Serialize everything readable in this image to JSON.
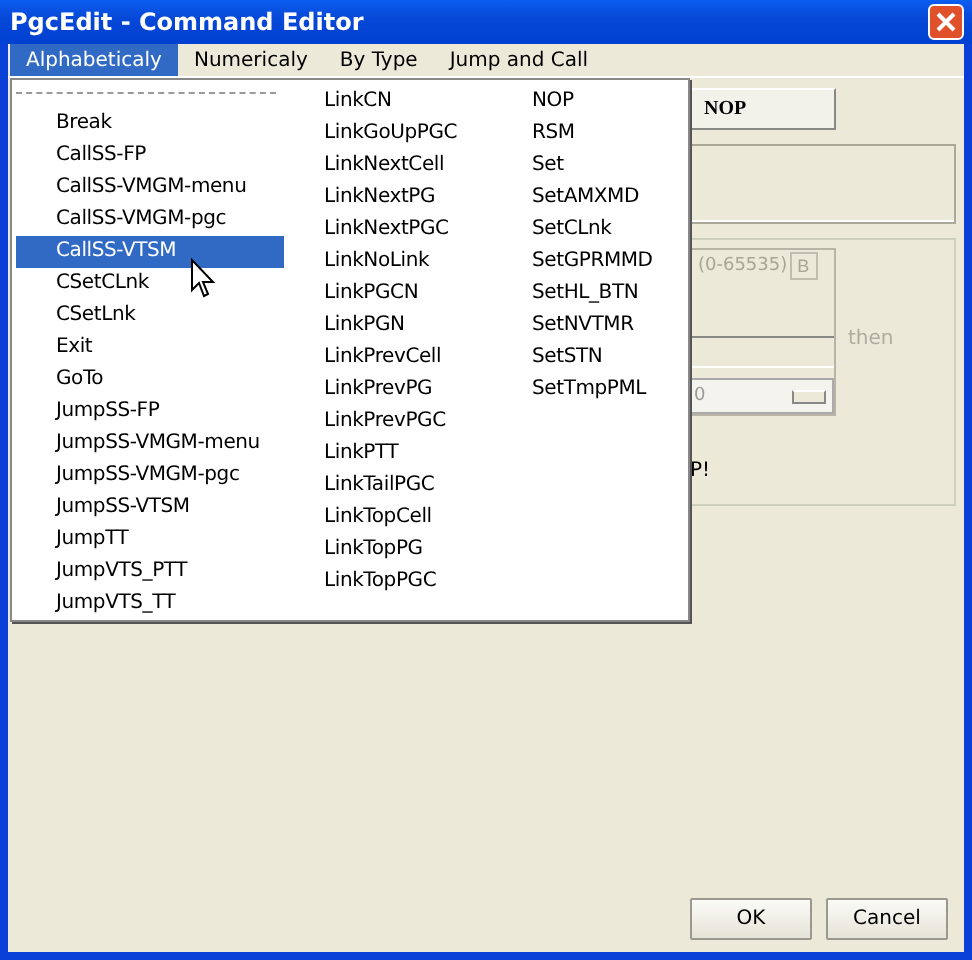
{
  "window": {
    "title": "PgcEdit - Command Editor"
  },
  "menu_bar": [
    {
      "label": "Alphabeticaly",
      "selected": true
    },
    {
      "label": "Numericaly",
      "selected": false
    },
    {
      "label": "By Type",
      "selected": false
    },
    {
      "label": "Jump and Call",
      "selected": false
    }
  ],
  "dropdown": {
    "columns": [
      [
        {
          "label": "Break",
          "selected": false
        },
        {
          "label": "CallSS-FP",
          "selected": false
        },
        {
          "label": "CallSS-VMGM-menu",
          "selected": false
        },
        {
          "label": "CallSS-VMGM-pgc",
          "selected": false
        },
        {
          "label": "CallSS-VTSM",
          "selected": true
        },
        {
          "label": "CSetCLnk",
          "selected": false
        },
        {
          "label": "CSetLnk",
          "selected": false
        },
        {
          "label": "Exit",
          "selected": false
        },
        {
          "label": "GoTo",
          "selected": false
        },
        {
          "label": "JumpSS-FP",
          "selected": false
        },
        {
          "label": "JumpSS-VMGM-menu",
          "selected": false
        },
        {
          "label": "JumpSS-VMGM-pgc",
          "selected": false
        },
        {
          "label": "JumpSS-VTSM",
          "selected": false
        },
        {
          "label": "JumpTT",
          "selected": false
        },
        {
          "label": "JumpVTS_PTT",
          "selected": false
        },
        {
          "label": "JumpVTS_TT",
          "selected": false
        }
      ],
      [
        {
          "label": "LinkCN",
          "selected": false
        },
        {
          "label": "LinkGoUpPGC",
          "selected": false
        },
        {
          "label": "LinkNextCell",
          "selected": false
        },
        {
          "label": "LinkNextPG",
          "selected": false
        },
        {
          "label": "LinkNextPGC",
          "selected": false
        },
        {
          "label": "LinkNoLink",
          "selected": false
        },
        {
          "label": "LinkPGCN",
          "selected": false
        },
        {
          "label": "LinkPGN",
          "selected": false
        },
        {
          "label": "LinkPrevCell",
          "selected": false
        },
        {
          "label": "LinkPrevPG",
          "selected": false
        },
        {
          "label": "LinkPrevPGC",
          "selected": false
        },
        {
          "label": "LinkPTT",
          "selected": false
        },
        {
          "label": "LinkTailPGC",
          "selected": false
        },
        {
          "label": "LinkTopCell",
          "selected": false
        },
        {
          "label": "LinkTopPG",
          "selected": false
        },
        {
          "label": "LinkTopPGC",
          "selected": false
        }
      ],
      [
        {
          "label": "NOP",
          "selected": false
        },
        {
          "label": "RSM",
          "selected": false
        },
        {
          "label": "Set",
          "selected": false
        },
        {
          "label": "SetAMXMD",
          "selected": false
        },
        {
          "label": "SetCLnk",
          "selected": false
        },
        {
          "label": "SetGPRMMD",
          "selected": false
        },
        {
          "label": "SetHL_BTN",
          "selected": false
        },
        {
          "label": "SetNVTMR",
          "selected": false
        },
        {
          "label": "SetSTN",
          "selected": false
        },
        {
          "label": "SetTmpPML",
          "selected": false
        }
      ]
    ]
  },
  "command_button": "NOP",
  "range_label": "(0-65535)",
  "b_button": "B",
  "then_label": "then",
  "combo_value": "0",
  "note_fragment": "P!",
  "buttons": [
    "OK",
    "Cancel"
  ]
}
